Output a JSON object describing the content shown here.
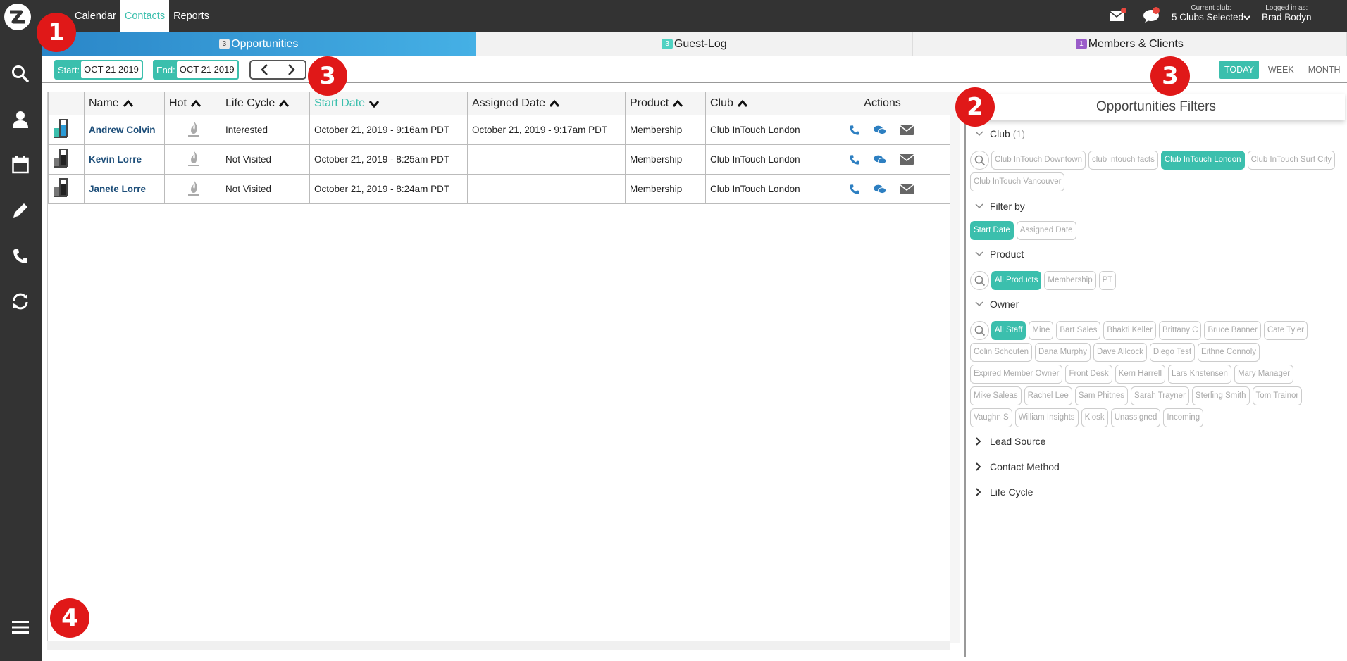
{
  "topnav": {
    "items": [
      "Calendar",
      "Contacts",
      "Reports"
    ],
    "active": "Contacts"
  },
  "header": {
    "current_club_label": "Current club:",
    "current_club_value": "5 Clubs Selected",
    "logged_in_label": "Logged in as:",
    "logged_in_value": "Brad Bodyn"
  },
  "tabs": [
    {
      "badge": "3",
      "label": "Opportunities"
    },
    {
      "badge": "3",
      "label": "Guest-Log"
    },
    {
      "badge": "1",
      "label": "Members & Clients"
    }
  ],
  "toolbar": {
    "start_label": "Start:",
    "start_value": "OCT 21 2019",
    "end_label": "End:",
    "end_value": "OCT 21 2019",
    "filter_count": "1",
    "periods": [
      "TODAY",
      "WEEK",
      "MONTH"
    ]
  },
  "table": {
    "headers": [
      "Name",
      "Hot",
      "Life Cycle",
      "Start Date",
      "Assigned Date",
      "Product",
      "Club",
      "Actions"
    ],
    "rows": [
      {
        "name": "Andrew Colvin",
        "lifecycle": "Interested",
        "start": "October 21, 2019 - 9:16am PDT",
        "assigned": "October 21, 2019 - 9:17am PDT",
        "product": "Membership",
        "club": "Club InTouch London"
      },
      {
        "name": "Kevin Lorre",
        "lifecycle": "Not Visited",
        "start": "October 21, 2019 - 8:25am PDT",
        "assigned": "",
        "product": "Membership",
        "club": "Club InTouch London"
      },
      {
        "name": "Janete Lorre",
        "lifecycle": "Not Visited",
        "start": "October 21, 2019 - 8:24am PDT",
        "assigned": "",
        "product": "Membership",
        "club": "Club InTouch London"
      }
    ]
  },
  "filters": {
    "title": "Opportunities Filters",
    "club_title": "Club",
    "club_count": "(1)",
    "clubs": [
      "Club InTouch Downtown",
      "club intouch facts",
      "Club InTouch London",
      "Club InTouch Surf City",
      "Club InTouch Vancouver"
    ],
    "filterby_title": "Filter by",
    "filterby": [
      "Start Date",
      "Assigned Date"
    ],
    "product_title": "Product",
    "products": [
      "All Products",
      "Membership",
      "PT"
    ],
    "owner_title": "Owner",
    "owners": [
      "All Staff",
      "Mine",
      "Bart Sales",
      "Bhakti Keller",
      "Brittany C",
      "Bruce Banner",
      "Cate Tyler",
      "Colin Schouten",
      "Dana Murphy",
      "Dave Allcock",
      "Diego Test",
      "Eithne Connoly",
      "Expired Member Owner",
      "Front Desk",
      "Kerri Harrell",
      "Lars Kristensen",
      "Mary Manager",
      "Mike Saleas",
      "Rachel Lee",
      "Sam Phitnes",
      "Sarah Trayner",
      "Sterling Smith",
      "Tom Trainor",
      "Vaughn S",
      "William Insights",
      "Kiosk",
      "Unassigned",
      "Incoming"
    ],
    "collapsed": [
      "Lead Source",
      "Contact Method",
      "Life Cycle"
    ]
  },
  "callouts": [
    "1",
    "2",
    "3",
    "3",
    "4"
  ],
  "colors": {
    "teal": "#3bbfad",
    "dark": "#333333",
    "blue": "#3a9ad9",
    "callout": "#e01818"
  }
}
